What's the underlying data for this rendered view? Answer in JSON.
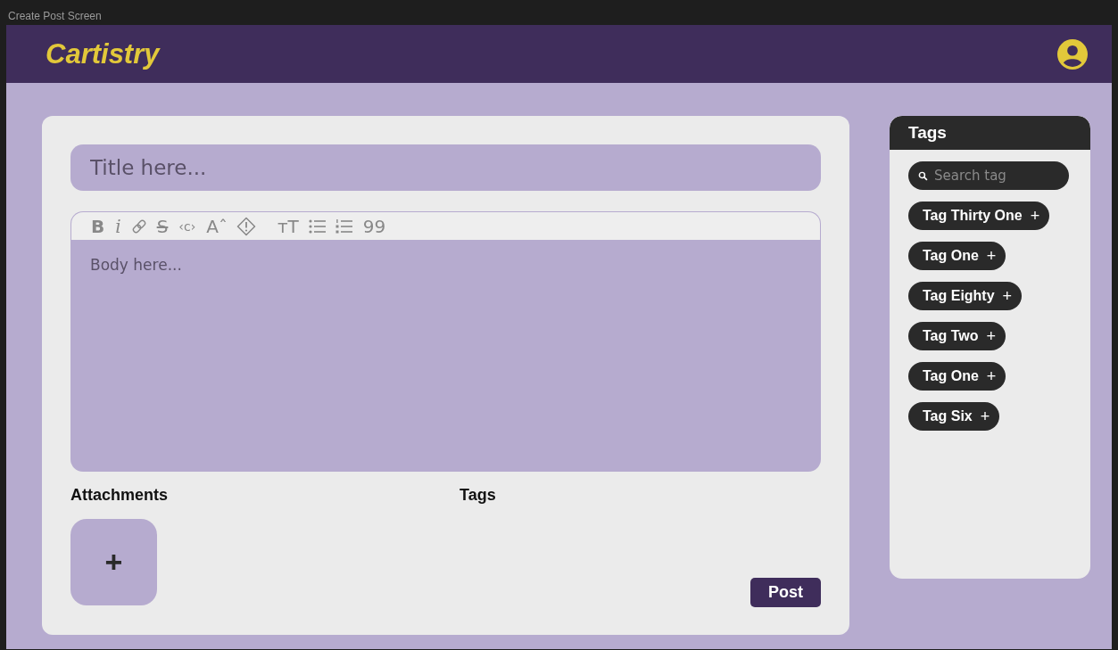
{
  "window": {
    "title": "Create Post Screen"
  },
  "header": {
    "logo": "Cartistry"
  },
  "editor": {
    "title": {
      "placeholder": "Title here..."
    },
    "toolbar": [
      {
        "kind": "bold",
        "label": "B"
      },
      {
        "kind": "italic",
        "label": "i"
      },
      {
        "kind": "link"
      },
      {
        "kind": "strike",
        "label": "S"
      },
      {
        "kind": "code",
        "label": "‹c›"
      },
      {
        "kind": "glyph",
        "label": "Aˆ"
      },
      {
        "kind": "alert"
      },
      {
        "kind": "separator"
      },
      {
        "kind": "glyph",
        "label": "ᴛT"
      },
      {
        "kind": "bullets"
      },
      {
        "kind": "numbers"
      },
      {
        "kind": "glyph",
        "label": "99"
      }
    ],
    "body": {
      "placeholder": "Body here..."
    }
  },
  "attachments": {
    "heading": "Attachments",
    "add_label": "+"
  },
  "tags_section": {
    "heading": "Tags"
  },
  "post_button": "Post",
  "sidebar": {
    "heading": "Tags",
    "search": {
      "placeholder": "Search tag"
    },
    "tags": [
      {
        "label": "Tag Thirty One",
        "action": "+"
      },
      {
        "label": "Tag One",
        "action": "+"
      },
      {
        "label": "Tag Eighty",
        "action": "+"
      },
      {
        "label": "Tag Two",
        "action": "+"
      },
      {
        "label": "Tag One",
        "action": "+"
      },
      {
        "label": "Tag Six",
        "action": "+"
      }
    ]
  }
}
